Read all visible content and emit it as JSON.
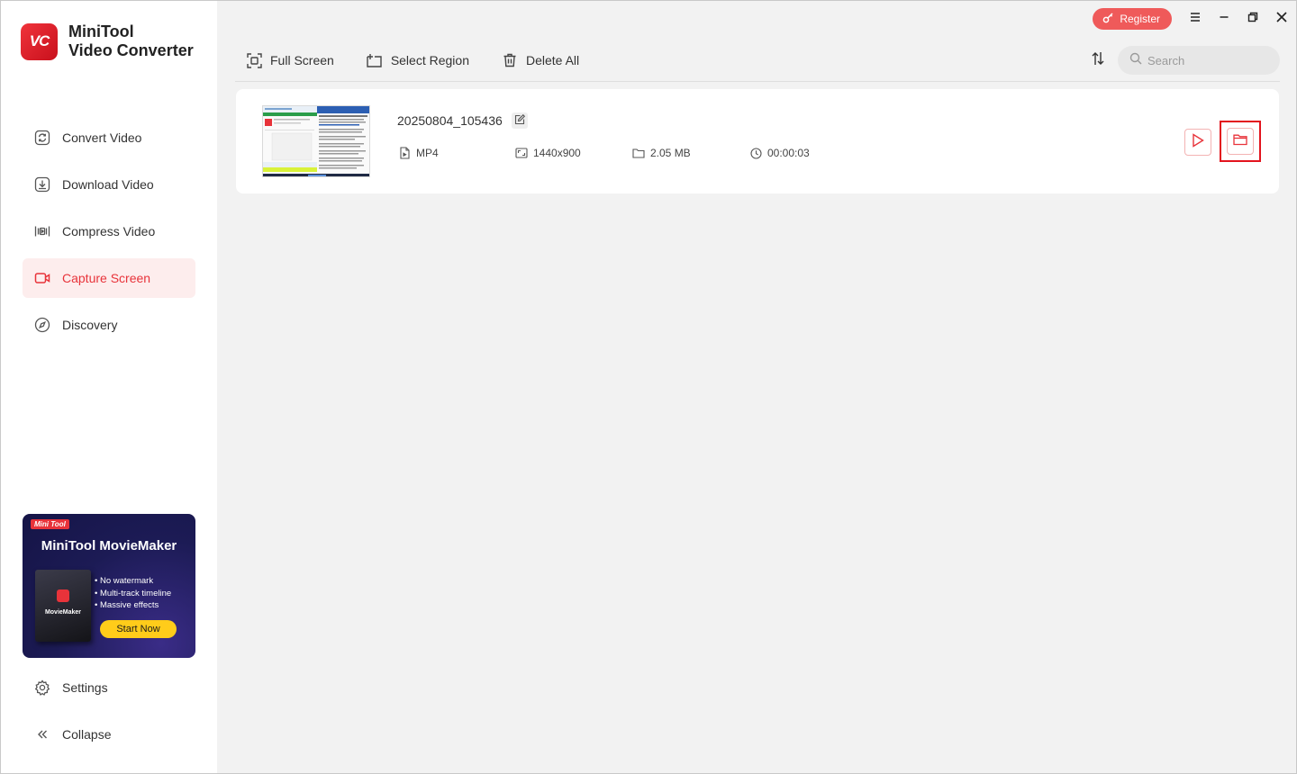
{
  "app": {
    "logo_text": "VC",
    "title_line1": "MiniTool",
    "title_line2": "Video Converter"
  },
  "sidebar": {
    "items": [
      {
        "label": "Convert Video",
        "icon": "convert-icon",
        "active": false
      },
      {
        "label": "Download Video",
        "icon": "download-icon",
        "active": false
      },
      {
        "label": "Compress Video",
        "icon": "compress-icon",
        "active": false
      },
      {
        "label": "Capture Screen",
        "icon": "video-camera-icon",
        "active": true
      },
      {
        "label": "Discovery",
        "icon": "compass-icon",
        "active": false
      }
    ],
    "bottom": [
      {
        "label": "Settings",
        "icon": "gear-icon"
      },
      {
        "label": "Collapse",
        "icon": "double-chevron-left-icon"
      }
    ],
    "promo": {
      "tag": "Mini Tool",
      "title": "MiniTool MovieMaker",
      "box_name": "MovieMaker",
      "features": [
        "No watermark",
        "Multi-track timeline",
        "Massive effects"
      ],
      "button": "Start Now"
    }
  },
  "titlebar": {
    "register_label": "Register"
  },
  "toolbar": {
    "full_screen": "Full Screen",
    "select_region": "Select Region",
    "delete_all": "Delete All"
  },
  "search": {
    "placeholder": "Search"
  },
  "recordings": [
    {
      "name": "20250804_105436",
      "format": "MP4",
      "resolution": "1440x900",
      "size": "2.05 MB",
      "duration": "00:00:03"
    }
  ],
  "colors": {
    "accent": "#e8333a",
    "active_bg": "#fdeded",
    "register_bg": "#ef5a5a",
    "promo_button": "#ffcc1a"
  }
}
